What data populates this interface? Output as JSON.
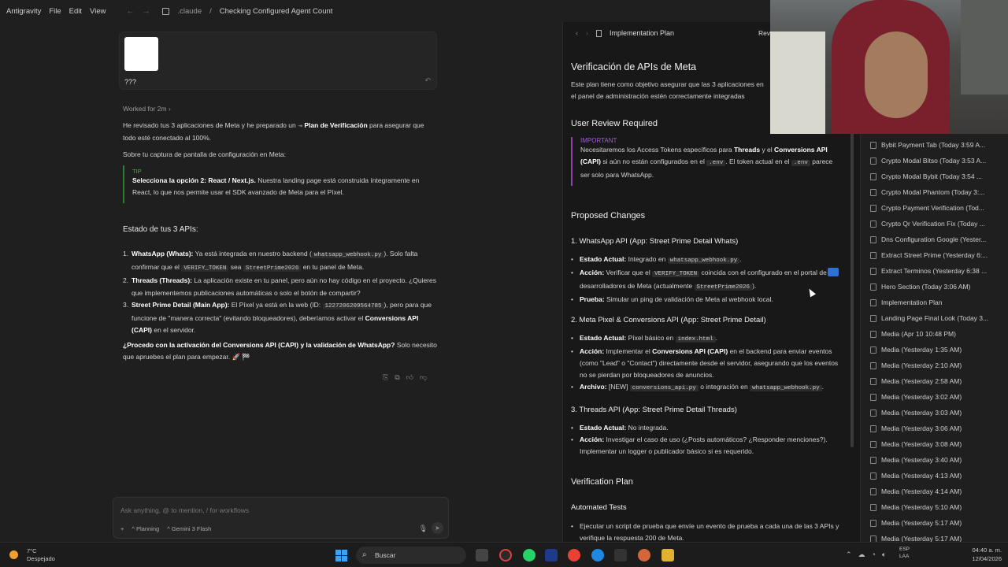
{
  "menubar": {
    "app": "Antigravity",
    "items": [
      "File",
      "Edit",
      "View"
    ],
    "breadcrumb_folder": ".claude",
    "breadcrumb_title": "Checking Configured Agent Count"
  },
  "chat": {
    "attachment_caption": "???",
    "worked_for": "Worked for 2m",
    "intro_1": "He revisado tus 3 aplicaciones de Meta y he preparado un",
    "intro_link": "Plan de Verificación",
    "intro_2": "para asegurar que todo esté conectado al 100%.",
    "about_screenshot": "Sobre tu captura de pantalla de configuración en Meta:",
    "tip_label": "TIP",
    "tip_bold": "Selecciona la opción 2: React / Next.js.",
    "tip_text": "Nuestra landing page está construida íntegramente en React, lo que nos permite usar el SDK avanzado de Meta para el Píxel.",
    "status_heading": "Estado de tus 3 APIs:",
    "api1_title": "WhatsApp (Whats):",
    "api1_text_a": "Ya está integrada en nuestro backend (",
    "api1_code": "whatsapp_webhook.py",
    "api1_text_b": "). Solo falta confirmar que el",
    "api1_code2": "VERIFY_TOKEN",
    "api1_text_c": "sea",
    "api1_code3": "StreetPrime2026",
    "api1_text_d": "en tu panel de Meta.",
    "api2_title": "Threads (Threads):",
    "api2_text": "La aplicación existe en tu panel, pero aún no hay código en el proyecto. ¿Quieres que implementemos publicaciones automáticas o solo el botón de compartir?",
    "api3_title": "Street Prime Detail (Main App):",
    "api3_text_a": "El Píxel ya está en la web (ID:",
    "api3_code": "1227206209564785",
    "api3_text_b": "), pero para que funcione de \"manera correcta\" (evitando bloqueadores), deberíamos activar el",
    "api3_bold": "Conversions API (CAPI)",
    "api3_text_c": "en el servidor.",
    "question_bold": "¿Procedo con la activación del Conversions API (CAPI) y la validación de WhatsApp?",
    "question_text": "Solo necesito que apruebes el plan para empezar. 🚀 🏁",
    "input_placeholder": "Ask anything, @ to mention, / for workflows",
    "mode_label": "Planning",
    "model_label": "Gemini 3 Flash"
  },
  "doc": {
    "tab_title": "Implementation Plan",
    "tab_review": "Revi",
    "h1": "Verificación de APIs de Meta",
    "intro": "Este plan tiene como objetivo asegurar que las 3 aplicaciones en el panel de administración estén correctamente integradas",
    "review_heading": "User Review Required",
    "important_label": "IMPORTANT",
    "important_a": "Necesitaremos los Access Tokens específicos para",
    "important_b1": "Threads",
    "important_c": "y el",
    "important_b2": "Conversions API (CAPI)",
    "important_d": "si aún no están configurados en el",
    "important_code1": ".env",
    "important_e": ". El token actual en el",
    "important_code2": ".env",
    "important_f": "parece ser solo para WhatsApp.",
    "proposed_heading": "Proposed Changes",
    "s1_heading": "1. WhatsApp API (App: Street Prime Detail Whats)",
    "s1_estado_lbl": "Estado Actual:",
    "s1_estado": "Integrado en",
    "s1_estado_code": "whatsapp_webhook.py",
    "s1_accion_lbl": "Acción:",
    "s1_accion_a": "Verificar que el",
    "s1_accion_code": "VERIFY_TOKEN",
    "s1_accion_b": "coincida con el configurado en el portal de desarrolladores de Meta (actualmente",
    "s1_accion_code2": "StreetPrime2026",
    "s1_accion_c": ").",
    "s1_prueba_lbl": "Prueba:",
    "s1_prueba": "Simular un ping de validación de Meta al webhook local.",
    "s2_heading": "2. Meta Pixel & Conversions API (App: Street Prime Detail)",
    "s2_estado_lbl": "Estado Actual:",
    "s2_estado": "Píxel básico en",
    "s2_estado_code": "index.html",
    "s2_accion_lbl": "Acción:",
    "s2_accion_a": "Implementar el",
    "s2_accion_bold": "Conversions API (CAPI)",
    "s2_accion_b": "en el backend para enviar eventos (como \"Lead\" o \"Contact\") directamente desde el servidor, asegurando que los eventos no se pierdan por bloqueadores de anuncios.",
    "s2_archivo_lbl": "Archivo:",
    "s2_archivo_a": "[NEW]",
    "s2_archivo_code": "conversions_api.py",
    "s2_archivo_b": "o integración en",
    "s2_archivo_code2": "whatsapp_webhook.py",
    "s3_heading": "3. Threads API (App: Street Prime Detail Threads)",
    "s3_estado_lbl": "Estado Actual:",
    "s3_estado": "No integrada.",
    "s3_accion_lbl": "Acción:",
    "s3_accion": "Investigar el caso de uso (¿Posts automáticos? ¿Responder menciones?). Implementar un logger o publicador básico si es requerido.",
    "verification_heading": "Verification Plan",
    "automated_heading": "Automated Tests",
    "auto_item": "Ejecutar un script de prueba que envíe un evento de prueba a cada una de las 3 APIs y verifique la respuesta 200 de Meta."
  },
  "sidebar": {
    "items": [
      "Bybit Payment Tab (Today 3:59 A...",
      "Crypto Modal Bitso (Today 3:53 A...",
      "Crypto Modal Bybit (Today 3:54 ...",
      "Crypto Modal Phantom (Today 3:...",
      "Crypto Payment Verification (Tod...",
      "Crypto Qr Verification Fix (Today ...",
      "Dns Configuration Google (Yester...",
      "Extract Street Prime (Yesterday 6:...",
      "Extract Terminos (Yesterday 6:38 ...",
      "Hero Section (Today 3:06 AM)",
      "Implementation Plan",
      "Landing Page Final Look (Today 3...",
      "Media (Apr 10 10:48 PM)",
      "Media (Yesterday 1:35 AM)",
      "Media (Yesterday 2:10 AM)",
      "Media (Yesterday 2:58 AM)",
      "Media (Yesterday 3:02 AM)",
      "Media (Yesterday 3:03 AM)",
      "Media (Yesterday 3:06 AM)",
      "Media (Yesterday 3:08 AM)",
      "Media (Yesterday 3:40 AM)",
      "Media (Yesterday 4:13 AM)",
      "Media (Yesterday 4:14 AM)",
      "Media (Yesterday 5:10 AM)",
      "Media (Yesterday 5:17 AM)",
      "Media (Yesterday 5:17 AM)"
    ]
  },
  "taskbar": {
    "temp": "7°C",
    "weather": "Despejado",
    "search": "Buscar",
    "lang1": "ESP",
    "lang2": "LAA",
    "time": "04:40 a. m.",
    "date": "12/04/2026"
  }
}
